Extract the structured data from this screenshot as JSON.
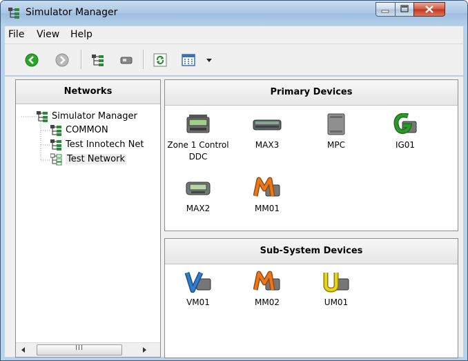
{
  "window": {
    "title": "Simulator Manager",
    "icon": "network-tree-icon",
    "controls": [
      "minimize-icon",
      "maximize-icon",
      "close-icon"
    ]
  },
  "menu": {
    "file": "File",
    "view": "View",
    "help": "Help"
  },
  "toolbar": {
    "buttons": [
      "back-arrow-icon",
      "forward-arrow-icon",
      "network-tree-icon",
      "device-icon",
      "refresh-icon",
      "grid-view-icon",
      "chevron-down-icon"
    ]
  },
  "networks": {
    "header": "Networks",
    "items": [
      {
        "label": "Simulator Manager",
        "level": 0
      },
      {
        "label": "COMMON",
        "level": 1
      },
      {
        "label": "Test Innotech Net",
        "level": 1
      },
      {
        "label": "Test Network",
        "level": 1,
        "selected": true
      }
    ],
    "scrollbar_grip": "III"
  },
  "primary": {
    "header": "Primary Devices",
    "devices": [
      {
        "name": "Zone 1 Control",
        "name2": "DDC",
        "icon": "ddc-controller-icon"
      },
      {
        "name": "MAX3",
        "icon": "max-controller-icon"
      },
      {
        "name": "MPC",
        "icon": "mpc-module-icon"
      },
      {
        "name": "IG01",
        "icon": "letter-g-device-icon"
      },
      {
        "name": "MAX2",
        "icon": "lcd-controller-icon"
      },
      {
        "name": "MM01",
        "icon": "letter-m-device-icon"
      }
    ]
  },
  "subsystem": {
    "header": "Sub-System Devices",
    "devices": [
      {
        "name": "VM01",
        "icon": "letter-v-device-icon"
      },
      {
        "name": "MM02",
        "icon": "letter-m-device-icon"
      },
      {
        "name": "UM01",
        "icon": "letter-u-device-icon"
      }
    ]
  },
  "colors": {
    "titlebar": "#b3cde8",
    "back_button": "#2aa52a",
    "letter_g": "#2b9a2b",
    "letter_m": "#e8781e",
    "letter_v": "#2f7ecb",
    "letter_u": "#e8d51a"
  }
}
